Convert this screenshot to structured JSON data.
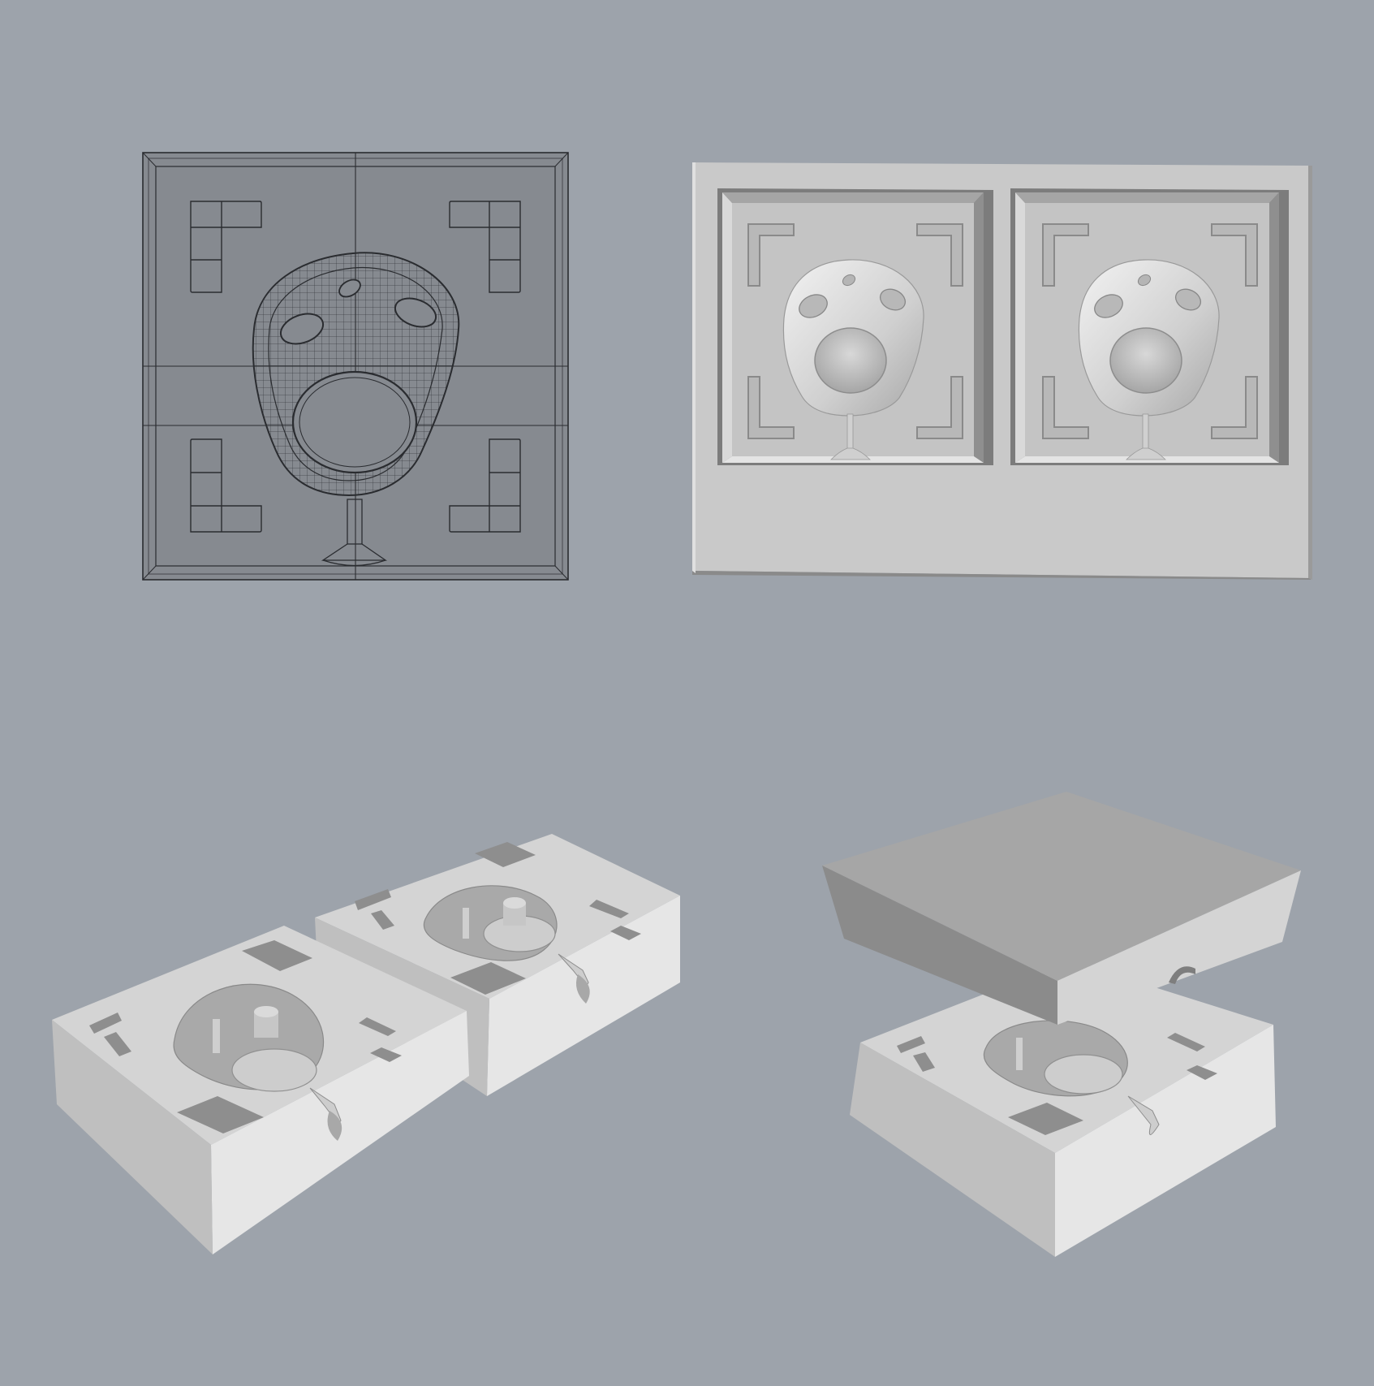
{
  "colors": {
    "background": "#9da3ab",
    "wire_base": "#868a90",
    "wire_line": "#2a2c30",
    "solid_top": "#d4d4d4",
    "solid_light": "#e5e5e5",
    "solid_mid": "#bdbdbd",
    "solid_dark": "#9a9a9a",
    "solid_shadow": "#7e7e7e"
  },
  "views": [
    {
      "name": "wireframe-top-view",
      "icon": "wireframe-mold-icon"
    },
    {
      "name": "rendered-double-mold-top-view",
      "icon": "double-mold-icon"
    },
    {
      "name": "perspective-mold-halves-view",
      "icon": "open-mold-halves-icon"
    },
    {
      "name": "perspective-closing-mold-view",
      "icon": "closing-mold-icon"
    }
  ]
}
